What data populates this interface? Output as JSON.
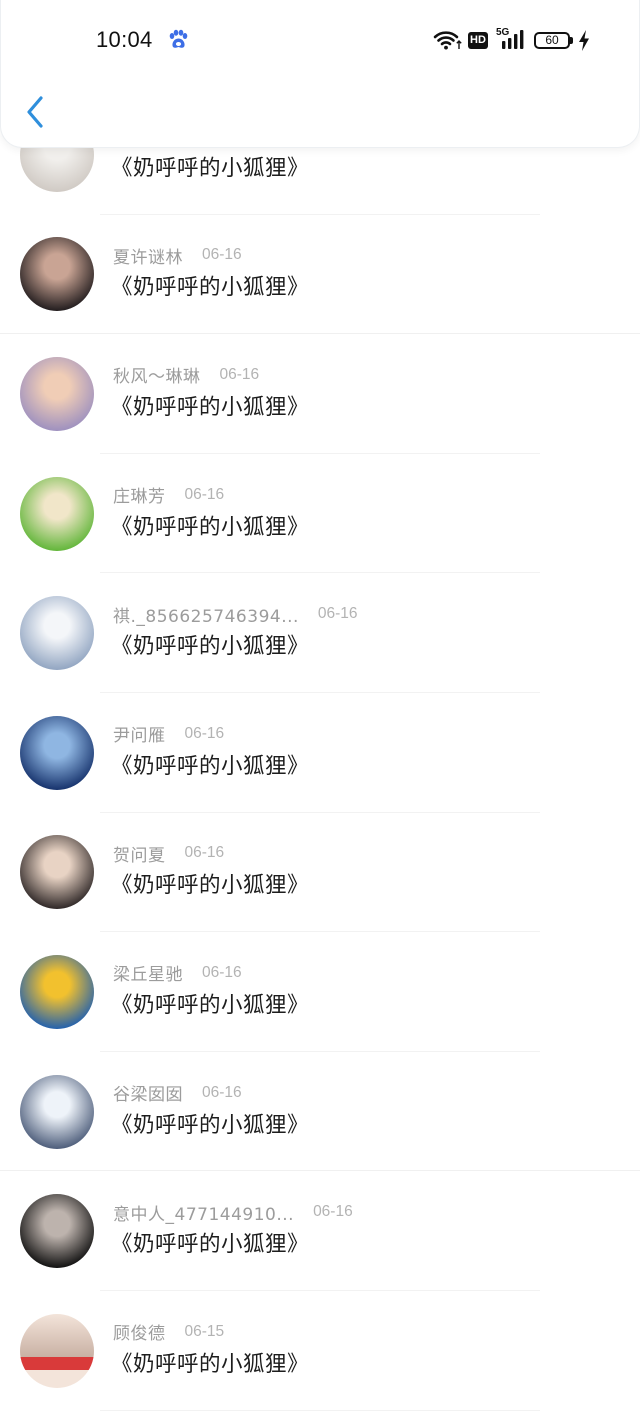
{
  "status_bar": {
    "time": "10:04",
    "hd_label": "HD",
    "network_label": "5G",
    "battery_level": "60",
    "icons": [
      "paw-icon",
      "wifi-icon",
      "hd-badge",
      "signal-icon",
      "battery-icon",
      "charging-icon"
    ]
  },
  "header": {
    "back_icon": "chevron-left-icon"
  },
  "colors": {
    "accent": "#2f8fdc",
    "paw": "#3d6ee6",
    "title_text": "#1d1d1d",
    "meta_text": "#9c9c9c"
  },
  "list": {
    "items": [
      {
        "title": "《奶呼呼的小狐狸》",
        "avatar_colors": [
          "#f1efec",
          "#cfc9c3"
        ]
      },
      {
        "name": "夏许谜林",
        "date": "06-16",
        "title": "《奶呼呼的小狐狸》",
        "avatar_colors": [
          "#c9a494",
          "#1f1a1c"
        ]
      },
      {
        "name": "秋风～琳琳",
        "date": "06-16",
        "title": "《奶呼呼的小狐狸》",
        "avatar_colors": [
          "#f0cdb6",
          "#9c8fbf"
        ]
      },
      {
        "name": "庄琳芳",
        "date": "06-16",
        "title": "《奶呼呼的小狐狸》",
        "avatar_colors": [
          "#f1e6c9",
          "#5fb537"
        ]
      },
      {
        "name": "祺._856625746394...",
        "date": "06-16",
        "title": "《奶呼呼的小狐狸》",
        "avatar_colors": [
          "#f4f6f9",
          "#8fa3c0"
        ]
      },
      {
        "name": "尹问雁",
        "date": "06-16",
        "title": "《奶呼呼的小狐狸》",
        "avatar_colors": [
          "#8fb6e2",
          "#14306a"
        ]
      },
      {
        "name": "贺问夏",
        "date": "06-16",
        "title": "《奶呼呼的小狐狸》",
        "avatar_colors": [
          "#e8d3c4",
          "#2b2424"
        ]
      },
      {
        "name": "梁丘星驰",
        "date": "06-16",
        "title": "《奶呼呼的小狐狸》",
        "avatar_colors": [
          "#f2c12e",
          "#1f5fb0"
        ]
      },
      {
        "name": "谷梁囡囡",
        "date": "06-16",
        "title": "《奶呼呼的小狐狸》",
        "avatar_colors": [
          "#eef3f9",
          "#4a5a78"
        ]
      },
      {
        "name": "意中人_477144910...",
        "date": "06-16",
        "title": "《奶呼呼的小狐狸》",
        "avatar_colors": [
          "#bdb3ad",
          "#0e0e0e"
        ]
      },
      {
        "name": "顾俊德",
        "date": "06-15",
        "title": "《奶呼呼的小狐狸》",
        "avatar_colors": [
          "#f3e4da",
          "#c9b1a4",
          "#d93a3a"
        ]
      }
    ]
  }
}
